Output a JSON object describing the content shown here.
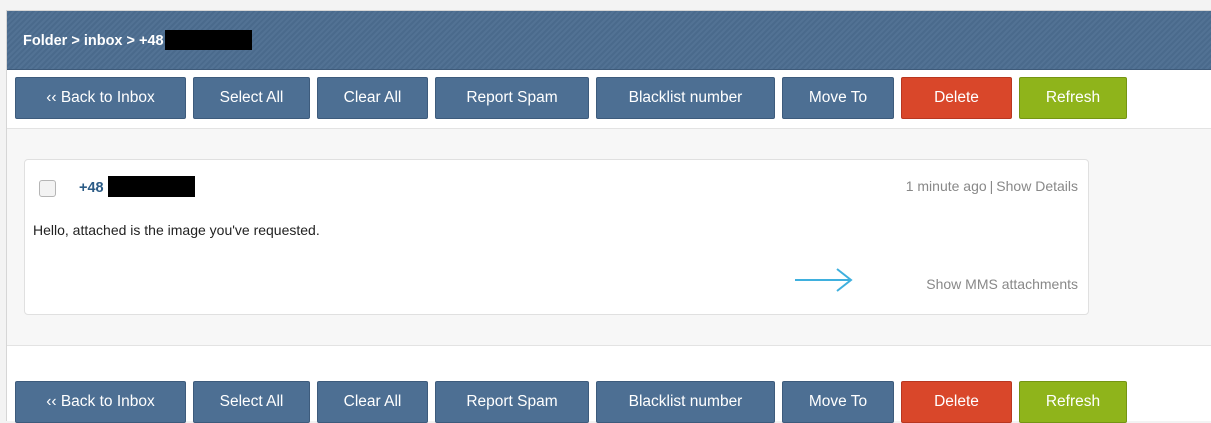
{
  "breadcrumb": {
    "prefix": "Folder > inbox > +48"
  },
  "toolbar": {
    "back": "‹‹ Back to Inbox",
    "select_all": "Select All",
    "clear_all": "Clear All",
    "report_spam": "Report Spam",
    "blacklist": "Blacklist number",
    "move_to": "Move To",
    "delete": "Delete",
    "refresh": "Refresh"
  },
  "message": {
    "sender_prefix": "+48",
    "time": "1 minute ago",
    "separator": "|",
    "details_link": "Show Details",
    "body": "Hello, attached is the image you've requested.",
    "mms_link": "Show MMS attachments"
  },
  "colors": {
    "header": "#4c6d91",
    "button_blue": "#4d6f93",
    "button_delete": "#d9472a",
    "button_refresh": "#8fb41b",
    "arrow": "#3fb0de"
  }
}
